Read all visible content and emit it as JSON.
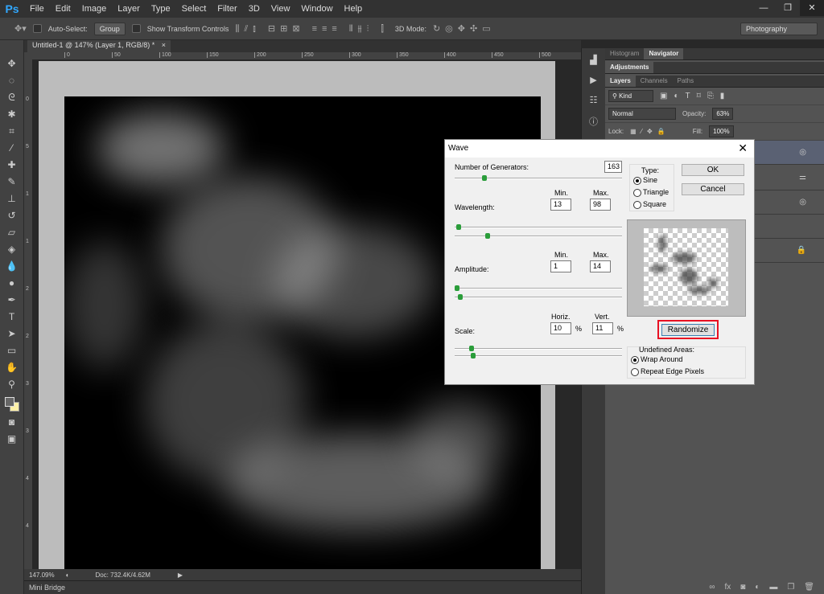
{
  "app": {
    "logo": "Ps",
    "menu": [
      "File",
      "Edit",
      "Image",
      "Layer",
      "Type",
      "Select",
      "Filter",
      "3D",
      "View",
      "Window",
      "Help"
    ],
    "window_controls": [
      "—",
      "❐",
      "✕"
    ]
  },
  "options": {
    "auto_select_label": "Auto-Select:",
    "auto_select_value": "Group",
    "show_transform_label": "Show Transform Controls",
    "mode_3d_label": "3D Mode:",
    "workspace": "Photography"
  },
  "document": {
    "tab_title": "Untitled-1 @ 147% (Layer 1, RGB/8) *",
    "close": "×",
    "ruler_h": [
      "0",
      "50",
      "100",
      "150",
      "200",
      "250",
      "300",
      "350",
      "400",
      "450",
      "500"
    ],
    "ruler_v": [
      "0",
      "5",
      "1",
      "1",
      "2",
      "2",
      "3",
      "3",
      "4",
      "4"
    ],
    "zoom": "147.09%",
    "doc_info": "Doc: 732.4K/4.62M"
  },
  "mini_bridge": {
    "label": "Mini Bridge"
  },
  "panels": {
    "top_tabs": [
      "Histogram",
      "Navigator"
    ],
    "adjustments": "Adjustments",
    "layer_tabs": [
      "Layers",
      "Channels",
      "Paths"
    ],
    "filter_kind": "Kind",
    "blend_mode": "Normal",
    "opacity_label": "Opacity:",
    "opacity_value": "63%",
    "lock_label": "Lock:",
    "fill_label": "Fill:",
    "fill_value": "100%"
  },
  "dialog": {
    "title": "Wave",
    "generators_label": "Number of Generators:",
    "generators_value": "163",
    "min_label": "Min.",
    "max_label": "Max.",
    "wavelength_label": "Wavelength:",
    "wavelength_min": "13",
    "wavelength_max": "98",
    "amplitude_label": "Amplitude:",
    "amplitude_min": "1",
    "amplitude_max": "14",
    "horiz_label": "Horiz.",
    "vert_label": "Vert.",
    "scale_label": "Scale:",
    "scale_h": "10",
    "scale_v": "11",
    "percent": "%",
    "type_label": "Type:",
    "types": [
      "Sine",
      "Triangle",
      "Square"
    ],
    "selected_type": "Sine",
    "ok": "OK",
    "cancel": "Cancel",
    "randomize": "Randomize",
    "undefined_label": "Undefined Areas:",
    "undefined_options": [
      "Wrap Around",
      "Repeat Edge Pixels"
    ],
    "selected_undefined": "Wrap Around",
    "sliders": {
      "generators": 0.17,
      "wavelength_min": 0.01,
      "wavelength_max": 0.19,
      "amplitude_min": 0.0,
      "amplitude_max": 0.02,
      "scale_h": 0.09,
      "scale_v": 0.1
    }
  },
  "colors": {
    "accent": "#31a8ff",
    "highlight": "#e81123"
  }
}
